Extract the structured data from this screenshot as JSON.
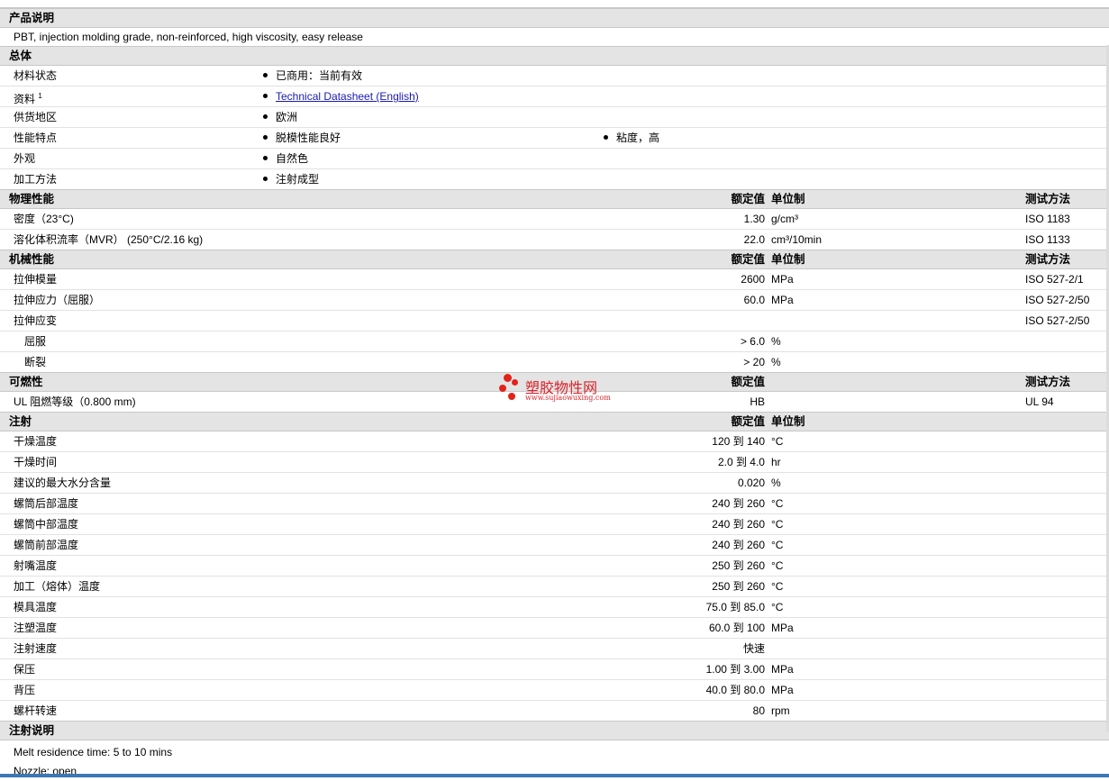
{
  "product_desc": {
    "title": "产品说明",
    "text": "PBT, injection molding grade, non-reinforced, high viscosity, easy release"
  },
  "general": {
    "title": "总体",
    "rows": [
      {
        "label": "材料状态",
        "bullets": [
          "已商用：当前有效"
        ]
      },
      {
        "label": "资料",
        "sup": "1",
        "link": "Technical Datasheet (English)"
      },
      {
        "label": "供货地区",
        "bullets": [
          "欧洲"
        ]
      },
      {
        "label": "性能特点",
        "bullets": [
          "脱模性能良好",
          "粘度，高"
        ]
      },
      {
        "label": "外观",
        "bullets": [
          "自然色"
        ]
      },
      {
        "label": "加工方法",
        "bullets": [
          "注射成型"
        ]
      }
    ]
  },
  "headers": {
    "nominal": "额定值",
    "unit": "单位制",
    "test": "测试方法"
  },
  "physical": {
    "title": "物理性能",
    "rows": [
      {
        "label": "密度（23°C)",
        "value": "1.30",
        "unit": "g/cm³",
        "test": "ISO 1183"
      },
      {
        "label": "溶化体积流率（MVR） (250°C/2.16 kg)",
        "value": "22.0",
        "unit": "cm³/10min",
        "test": "ISO 1133"
      }
    ]
  },
  "mechanical": {
    "title": "机械性能",
    "rows": [
      {
        "label": "拉伸模量",
        "value": "2600",
        "unit": "MPa",
        "test": "ISO 527-2/1"
      },
      {
        "label": "拉伸应力（屈服）",
        "value": "60.0",
        "unit": "MPa",
        "test": "ISO 527-2/50"
      },
      {
        "label": "拉伸应变",
        "value": "",
        "unit": "",
        "test": "ISO 527-2/50"
      },
      {
        "label": "屈服",
        "value": "> 6.0",
        "unit": "%",
        "test": "",
        "sub": true
      },
      {
        "label": "断裂",
        "value": "> 20",
        "unit": "%",
        "test": "",
        "sub": true
      }
    ]
  },
  "flammability": {
    "title": "可燃性",
    "rows": [
      {
        "label": "UL 阻燃等级（0.800 mm)",
        "value": "HB",
        "unit": "",
        "test": "UL 94"
      }
    ]
  },
  "injection": {
    "title": "注射",
    "rows": [
      {
        "label": "干燥温度",
        "value": "120 到  140",
        "unit": "°C"
      },
      {
        "label": "干燥时间",
        "value": "2.0 到  4.0",
        "unit": "hr"
      },
      {
        "label": "建议的最大水分含量",
        "value": "0.020",
        "unit": "%"
      },
      {
        "label": "螺筒后部温度",
        "value": "240 到  260",
        "unit": "°C"
      },
      {
        "label": "螺筒中部温度",
        "value": "240 到  260",
        "unit": "°C"
      },
      {
        "label": "螺筒前部温度",
        "value": "240 到  260",
        "unit": "°C"
      },
      {
        "label": "射嘴温度",
        "value": "250 到  260",
        "unit": "°C"
      },
      {
        "label": "加工（熔体）温度",
        "value": "250 到  260",
        "unit": "°C"
      },
      {
        "label": "模具温度",
        "value": "75.0 到  85.0",
        "unit": "°C"
      },
      {
        "label": "注塑温度",
        "value": "60.0 到  100",
        "unit": "MPa"
      },
      {
        "label": "注射速度",
        "value": "快速",
        "unit": ""
      },
      {
        "label": "保压",
        "value": "1.00 到  3.00",
        "unit": "MPa"
      },
      {
        "label": "背压",
        "value": "40.0 到  80.0",
        "unit": "MPa"
      },
      {
        "label": "螺杆转速",
        "value": "80",
        "unit": "rpm"
      }
    ]
  },
  "injection_notes": {
    "title": "注射说明",
    "lines": [
      "Melt residence time: 5 to 10 mins",
      "Nozzle: open"
    ]
  },
  "watermark": {
    "name": "塑胶物性网",
    "url": "www.sujiaowuxing.com"
  },
  "colors": {
    "header_bg": "#e4e4e4",
    "link": "#1a1ab0",
    "watermark": "#d9232a",
    "bottom_bar": "#3c78b4"
  }
}
